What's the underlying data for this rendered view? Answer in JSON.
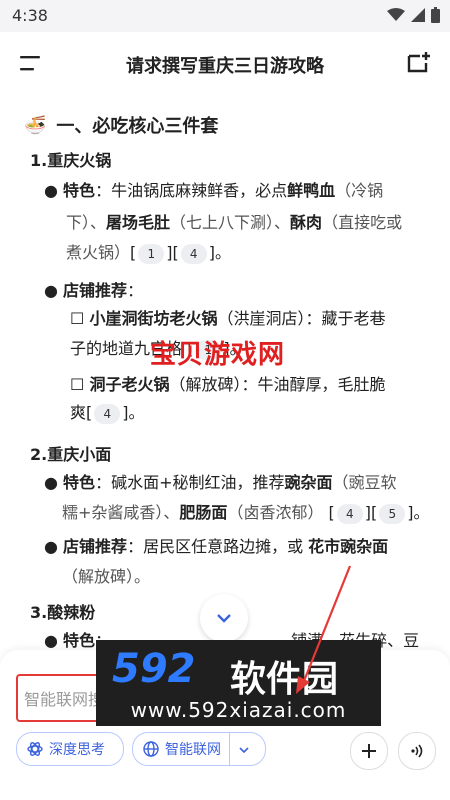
{
  "status": {
    "time": "4:38"
  },
  "header": {
    "title": "请求撰写重庆三日游攻略"
  },
  "section": {
    "heading": "一、必吃核心三件套"
  },
  "items": {
    "hotpot_title": "1.重庆火锅",
    "hotpot_feature_label": "特色",
    "hotpot_feature_l1_a": "：牛油锅底麻辣鲜香，必点",
    "hotpot_feature_l1_b": "鲜鸭血",
    "hotpot_feature_l1_c": "（冷锅",
    "hotpot_feature_l2_a": "下）、",
    "hotpot_feature_l2_b": "屠场毛肚",
    "hotpot_feature_l2_c": "（七上八下涮）、",
    "hotpot_feature_l2_d": "酥肉",
    "hotpot_feature_l2_e": "（直接吃或",
    "hotpot_feature_l3_a": "煮火锅）",
    "cite_1": "1",
    "cite_4": "4",
    "cite_5": "5",
    "hotpot_shop_label": "店铺推荐",
    "shop1_a": "小崖洞街坊老火锅",
    "shop1_b": "（洪崖洞店）：藏于老巷",
    "shop1_l2": "子的地道九宫格",
    "shop2_a": "洞子老火锅",
    "shop2_b": "（解放碑）：牛油醇厚，毛肚脆",
    "shop2_l2": "爽",
    "noodle_title": "2.重庆小面",
    "noodle_feature_label": "特色",
    "noodle_l1_a": "：碱水面+秘制红油，推荐",
    "noodle_l1_b": "豌杂面",
    "noodle_l1_c": "（豌豆软",
    "noodle_l2_a": "糯+杂酱咸香）、",
    "noodle_l2_b": "肥肠面",
    "noodle_l2_c": "（卤香浓郁）",
    "noodle_shop_label": "店铺推荐",
    "noodle_shop_a": "：居民区任意路边摊，或 ",
    "noodle_shop_b": "花市豌杂面",
    "noodle_shop_l2": "（解放碑）。",
    "sour_title": "3.酸辣粉",
    "sour_feature_label": "特色",
    "sour_l1_tail": "铺满",
    "sour_l1_end": "花生碎、豆"
  },
  "watermark": {
    "text": "宝贝游戏网"
  },
  "composer": {
    "placeholder": "智能联网搜",
    "deep_think": "深度思考",
    "web_search": "智能联网"
  },
  "logo": {
    "brand_num": "592",
    "brand_cn": "软件园",
    "url": "www.592xiazai.com"
  },
  "colors": {
    "accent": "#3d63dd",
    "highlight": "#e53935"
  }
}
